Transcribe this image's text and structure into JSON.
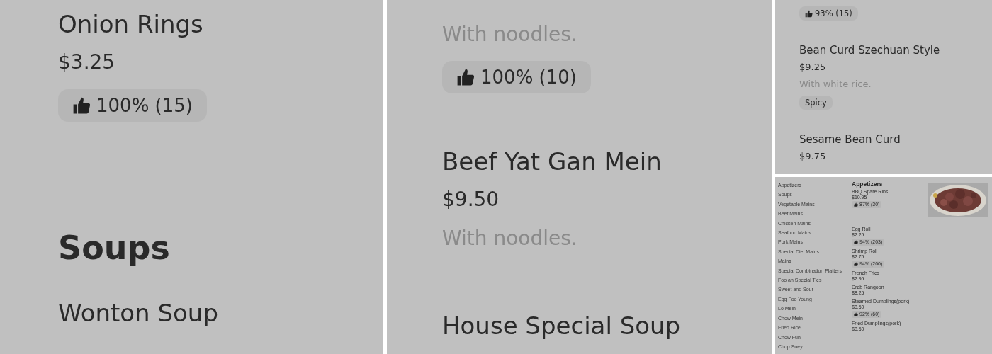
{
  "panels": [
    {
      "kind": "closeup",
      "entries": [
        {
          "kind": "item",
          "name": "Onion Rings",
          "price": "$3.25",
          "rating": "100% (15)"
        },
        {
          "kind": "heading",
          "text": "Soups"
        },
        {
          "kind": "item",
          "name": "Wonton Soup"
        }
      ]
    },
    {
      "kind": "closeup",
      "entries": [
        {
          "kind": "item",
          "description": "With noodles.",
          "rating": "100% (10)"
        },
        {
          "kind": "item",
          "name": "Beef Yat Gan Mein",
          "price": "$9.50",
          "description": "With noodles."
        },
        {
          "kind": "item",
          "name": "House Special Soup"
        }
      ]
    },
    {
      "kind": "detail",
      "entries": [
        {
          "kind": "item",
          "rating": "93% (15)"
        },
        {
          "kind": "item",
          "name": "Bean Curd Szechuan Style",
          "price": "$9.25",
          "description": "With white rice.",
          "tags": [
            "Spicy"
          ]
        },
        {
          "kind": "item",
          "name": "Sesame Bean Curd",
          "price": "$9.75"
        }
      ]
    },
    {
      "kind": "overview",
      "categories": [
        {
          "label": "Appetizers",
          "selected": true
        },
        {
          "label": "Soups",
          "selected": false
        },
        {
          "label": "Vegetable Mains",
          "selected": false
        },
        {
          "label": "Beef Mains",
          "selected": false
        },
        {
          "label": "Chicken Mains",
          "selected": false
        },
        {
          "label": "Seafood Mains",
          "selected": false
        },
        {
          "label": "Pork Mains",
          "selected": false
        },
        {
          "label": "Special Diet Mains",
          "selected": false
        },
        {
          "label": "Mains",
          "selected": false
        },
        {
          "label": "Special Combination Platters",
          "selected": false
        },
        {
          "label": "Foo an Special Ties",
          "selected": false
        },
        {
          "label": "Sweet and Sour",
          "selected": false
        },
        {
          "label": "Egg Foo Young",
          "selected": false
        },
        {
          "label": "Lo Mein",
          "selected": false
        },
        {
          "label": "Chow Mein",
          "selected": false
        },
        {
          "label": "Fried Rice",
          "selected": false
        },
        {
          "label": "Chow Fun",
          "selected": false
        },
        {
          "label": "Chop Suey",
          "selected": false
        }
      ],
      "entries": [
        {
          "kind": "heading",
          "text": "Appetizers"
        },
        {
          "kind": "item",
          "name": "BBQ Spare Ribs",
          "price": "$10.95",
          "rating": "87% (30)"
        },
        {
          "kind": "item",
          "name": "Egg Roll",
          "price": "$2.25",
          "rating": "94% (203)"
        },
        {
          "kind": "item",
          "name": "Shrimp Roll",
          "price": "$2.75",
          "rating": "94% (200)"
        },
        {
          "kind": "item",
          "name": "French Fries",
          "price": "$2.95"
        },
        {
          "kind": "item",
          "name": "Crab Rangoon",
          "price": "$8.25"
        },
        {
          "kind": "item",
          "name": "Steamed Dumplings(pork)",
          "price": "$8.50",
          "rating": "92% (60)"
        },
        {
          "kind": "item",
          "name": "Fried Dumplings(pork)",
          "price": "$8.50"
        }
      ]
    }
  ]
}
